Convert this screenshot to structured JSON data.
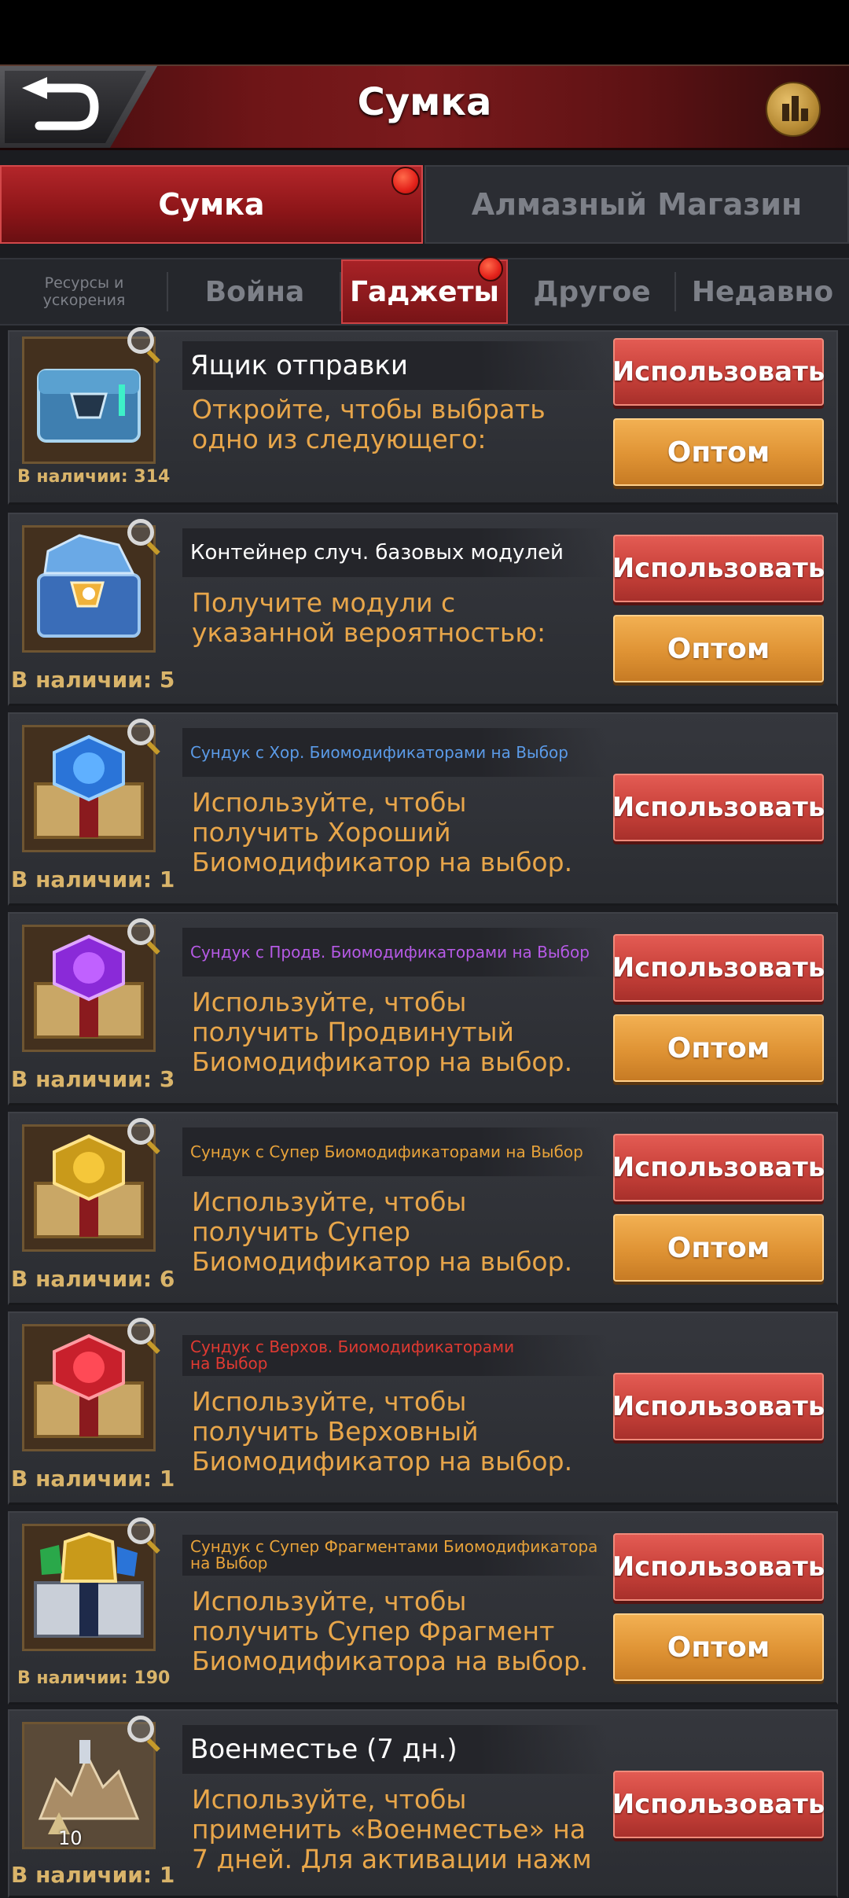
{
  "header": {
    "title": "Сумка"
  },
  "colors": {
    "accent_red": "#b3262a",
    "use_button": "#d2463f",
    "bulk_button": "#e19634",
    "desc_text": "#e8a64a",
    "qty_text": "#d9b46a"
  },
  "main_tabs": [
    {
      "label": "Сумка",
      "active": true,
      "badge": true
    },
    {
      "label": "Алмазный Магазин",
      "active": false,
      "badge": false
    }
  ],
  "sub_tabs": [
    {
      "label": "Ресурсы и ускорения",
      "active": false
    },
    {
      "label": "Война",
      "active": false
    },
    {
      "label": "Гаджеты",
      "active": true,
      "badge": true
    },
    {
      "label": "Другое",
      "active": false
    },
    {
      "label": "Недавно",
      "active": false
    }
  ],
  "buttons": {
    "use": "Использовать",
    "bulk": "Оптом"
  },
  "items": [
    {
      "name": "Ящик отправки",
      "name_color": "#ffffff",
      "desc": "Откройте, чтобы выбрать одно из следующего:",
      "qty": "В наличии: 314",
      "icon": "dispatch-crate-icon",
      "bulk": true
    },
    {
      "name": "Контейнер случ. базовых модулей",
      "name_color": "#ffffff",
      "desc": "Получите модули с указанной вероятностью:",
      "qty": "В наличии: 5",
      "icon": "module-container-icon",
      "bulk": true
    },
    {
      "name": "Сундук с Хор. Биомодификаторами на Выбор",
      "name_color": "#5b9be8",
      "desc": "Используйте, чтобы получить Хороший Биомодификатор на выбор.",
      "qty": "В наличии: 1",
      "icon": "blue-biomod-chest-icon",
      "bulk": false
    },
    {
      "name": "Сундук с Продв. Биомодификаторами на Выбор",
      "name_color": "#b65ae6",
      "desc": "Используйте, чтобы получить Продвинутый Биомодификатор на выбор.",
      "qty": "В наличии: 3",
      "icon": "purple-biomod-chest-icon",
      "bulk": true
    },
    {
      "name": "Сундук с Супер Биомодификаторами на Выбор",
      "name_color": "#e8a33a",
      "desc": "Используйте, чтобы получить Супер Биомодификатор на выбор.",
      "qty": "В наличии: 6",
      "icon": "gold-biomod-chest-icon",
      "bulk": true
    },
    {
      "name": "Сундук с Верхов. Биомодификаторами на Выбор",
      "name_color": "#e03a32",
      "desc": "Используйте, чтобы получить Верховный Биомодификатор на выбор.",
      "qty": "В наличии: 1",
      "icon": "red-biomod-chest-icon",
      "bulk": false
    },
    {
      "name": "Сундук с Супер Фрагментами Биомодификатора на Выбор",
      "name_color": "#e8a33a",
      "desc": "Используйте, чтобы получить Супер Фрагмент Биомодификатора на выбор.",
      "qty": "В наличии: 190",
      "icon": "fragment-chest-icon",
      "bulk": true
    },
    {
      "name": "Военместье (7 дн.)",
      "name_color": "#ffffff",
      "desc": "Используйте, чтобы применить «Военместье» на 7 дней. Для активации нажм",
      "qty": "В наличии: 1",
      "icon": "city-skin-icon",
      "icon_level": "10",
      "bulk": false
    }
  ]
}
